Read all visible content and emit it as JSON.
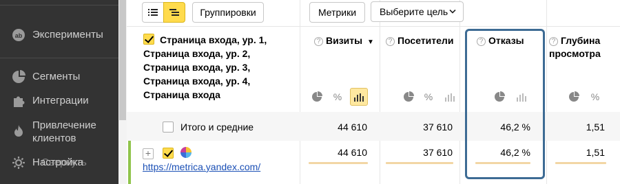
{
  "sidebar": {
    "items": [
      {
        "label": "Эксперименты",
        "icon": "ab-test-icon"
      },
      {
        "label": "Сегменты",
        "icon": "pie-chart-icon"
      },
      {
        "label": "Интеграции",
        "icon": "puzzle-icon"
      },
      {
        "label": "Привлечение клиентов",
        "icon": "flame-icon"
      },
      {
        "label": "Настройка",
        "icon": "gear-icon"
      }
    ],
    "overlay_label": "Свернуть"
  },
  "toolbar": {
    "groupings": "Группировки",
    "metrics": "Метрики",
    "goal": "Выберите цель"
  },
  "dimension": {
    "header": "Страница входа, ур. 1, Страница входа, ур. 2, Страница входа, ур. 3, Страница входа, ур. 4, Страница входа"
  },
  "columns": [
    {
      "label": "Визиты",
      "sort": "▼"
    },
    {
      "label": "Посетители"
    },
    {
      "label": "Отказы"
    },
    {
      "label": "Глубина просмотра"
    }
  ],
  "rows": {
    "total": {
      "label": "Итого и средние",
      "values": [
        "44 610",
        "37 610",
        "46,2 %",
        "1,51"
      ]
    },
    "item": {
      "url": "https://metrica.yandex.com/",
      "values": [
        "44 610",
        "37 610",
        "46,2 %",
        "1,51"
      ]
    }
  },
  "colors": {
    "sidebar_bg": "#333333",
    "accent_yellow": "#ffdb4d",
    "highlight_border": "#3d6b94",
    "bar": "#f2d6a4",
    "link": "#1a4fb5"
  }
}
